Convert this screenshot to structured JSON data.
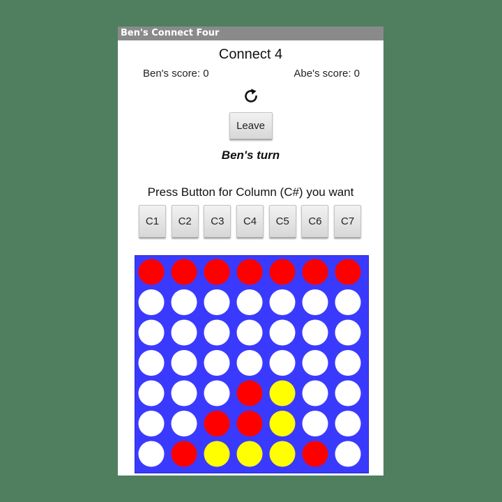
{
  "window": {
    "title": "Ben's Connect Four"
  },
  "header": {
    "title": "Connect 4"
  },
  "scores": {
    "left": "Ben's score: 0",
    "right": "Abe's score: 0"
  },
  "controls": {
    "refresh_icon": "refresh-icon",
    "leave_label": "Leave"
  },
  "status": {
    "turn": "Ben's turn"
  },
  "instructions": "Press Button for Column (C#) you want",
  "columns": [
    "C1",
    "C2",
    "C3",
    "C4",
    "C5",
    "C6",
    "C7"
  ],
  "colors": {
    "board": "#3a3aff",
    "empty": "#ffffff",
    "red": "#ff0000",
    "yellow": "#ffff00"
  },
  "board": [
    [
      "R",
      "R",
      "R",
      "R",
      "R",
      "R",
      "R"
    ],
    [
      "E",
      "E",
      "E",
      "E",
      "E",
      "E",
      "E"
    ],
    [
      "E",
      "E",
      "E",
      "E",
      "E",
      "E",
      "E"
    ],
    [
      "E",
      "E",
      "E",
      "E",
      "E",
      "E",
      "E"
    ],
    [
      "E",
      "E",
      "E",
      "R",
      "Y",
      "E",
      "E"
    ],
    [
      "E",
      "E",
      "R",
      "R",
      "Y",
      "E",
      "E"
    ],
    [
      "E",
      "R",
      "Y",
      "Y",
      "Y",
      "R",
      "E"
    ]
  ]
}
